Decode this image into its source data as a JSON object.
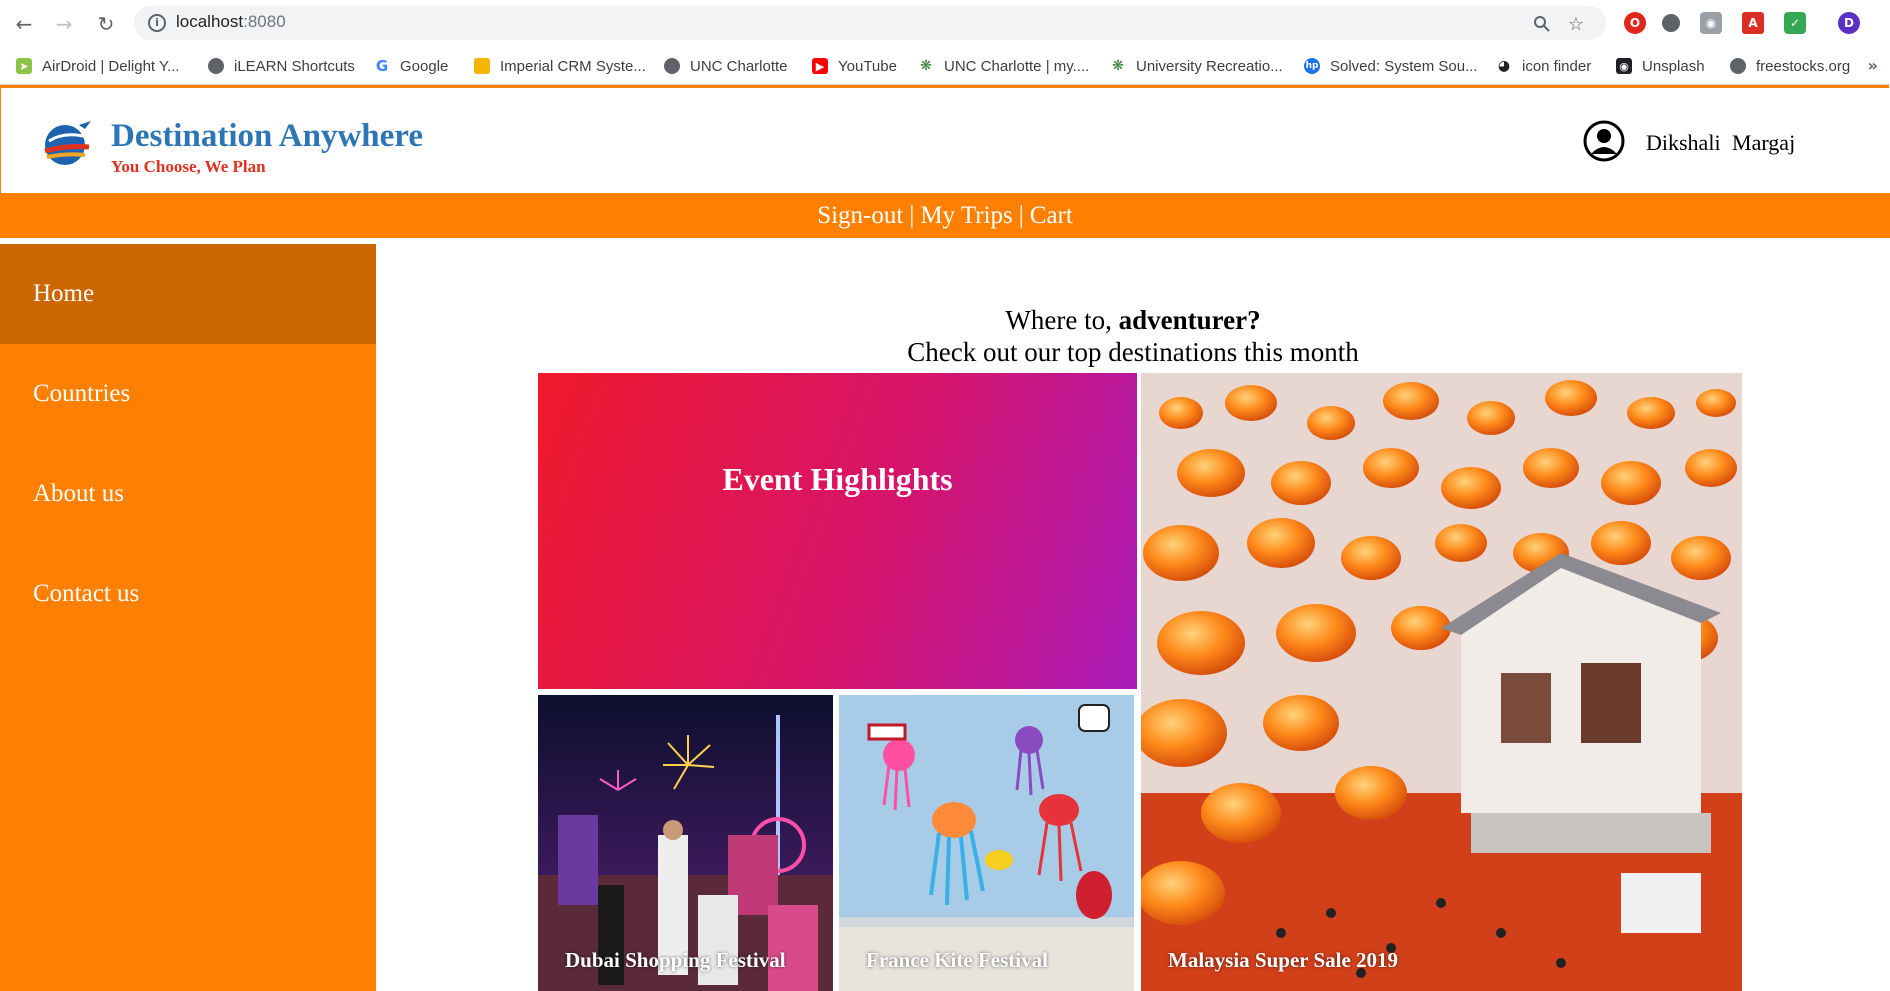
{
  "browser": {
    "url_host": "localhost",
    "url_port": ":8080",
    "profile_initial": "D",
    "bookmarks": [
      {
        "label": "AirDroid | Delight Y...",
        "icon": "airdroid-icon"
      },
      {
        "label": "iLEARN Shortcuts",
        "icon": "globe-icon"
      },
      {
        "label": "Google",
        "icon": "google-icon"
      },
      {
        "label": "Imperial CRM Syste...",
        "icon": "megaphone-icon"
      },
      {
        "label": "UNC Charlotte",
        "icon": "globe-icon"
      },
      {
        "label": "YouTube",
        "icon": "youtube-icon"
      },
      {
        "label": "UNC Charlotte | my....",
        "icon": "unc-icon"
      },
      {
        "label": "University Recreatio...",
        "icon": "unc-icon"
      },
      {
        "label": "Solved: System Sou...",
        "icon": "hp-icon"
      },
      {
        "label": "icon finder",
        "icon": "eye-icon"
      },
      {
        "label": "Unsplash",
        "icon": "camera-icon"
      },
      {
        "label": "freestocks.org",
        "icon": "globe-icon"
      }
    ],
    "more_label": "»"
  },
  "site": {
    "brand_name": "Destination Anywhere",
    "tagline": "You Choose, We Plan",
    "user_name": "Dikshali  Margaj",
    "top_links": {
      "signout": "Sign-out",
      "trips": "My Trips",
      "cart": "Cart",
      "separator": "|"
    }
  },
  "sidebar": {
    "items": [
      {
        "label": "Home",
        "active": true
      },
      {
        "label": "Countries",
        "active": false
      },
      {
        "label": "About us",
        "active": false
      },
      {
        "label": "Contact us",
        "active": false
      }
    ]
  },
  "main": {
    "greeting_prefix": "Where to, ",
    "greeting_bold": "adventurer?",
    "subheading": "Check out our top destinations this month",
    "event_title": "Event Highlights",
    "tiles": {
      "dubai": "Dubai Shopping Festival",
      "france": "France Kite Festival",
      "malaysia": "Malaysia Super Sale 2019"
    }
  },
  "colors": {
    "brand_orange": "#ff8000",
    "sidebar_active": "#cc6600",
    "brand_blue": "#2e75b6",
    "tagline_red": "#e0301e"
  }
}
